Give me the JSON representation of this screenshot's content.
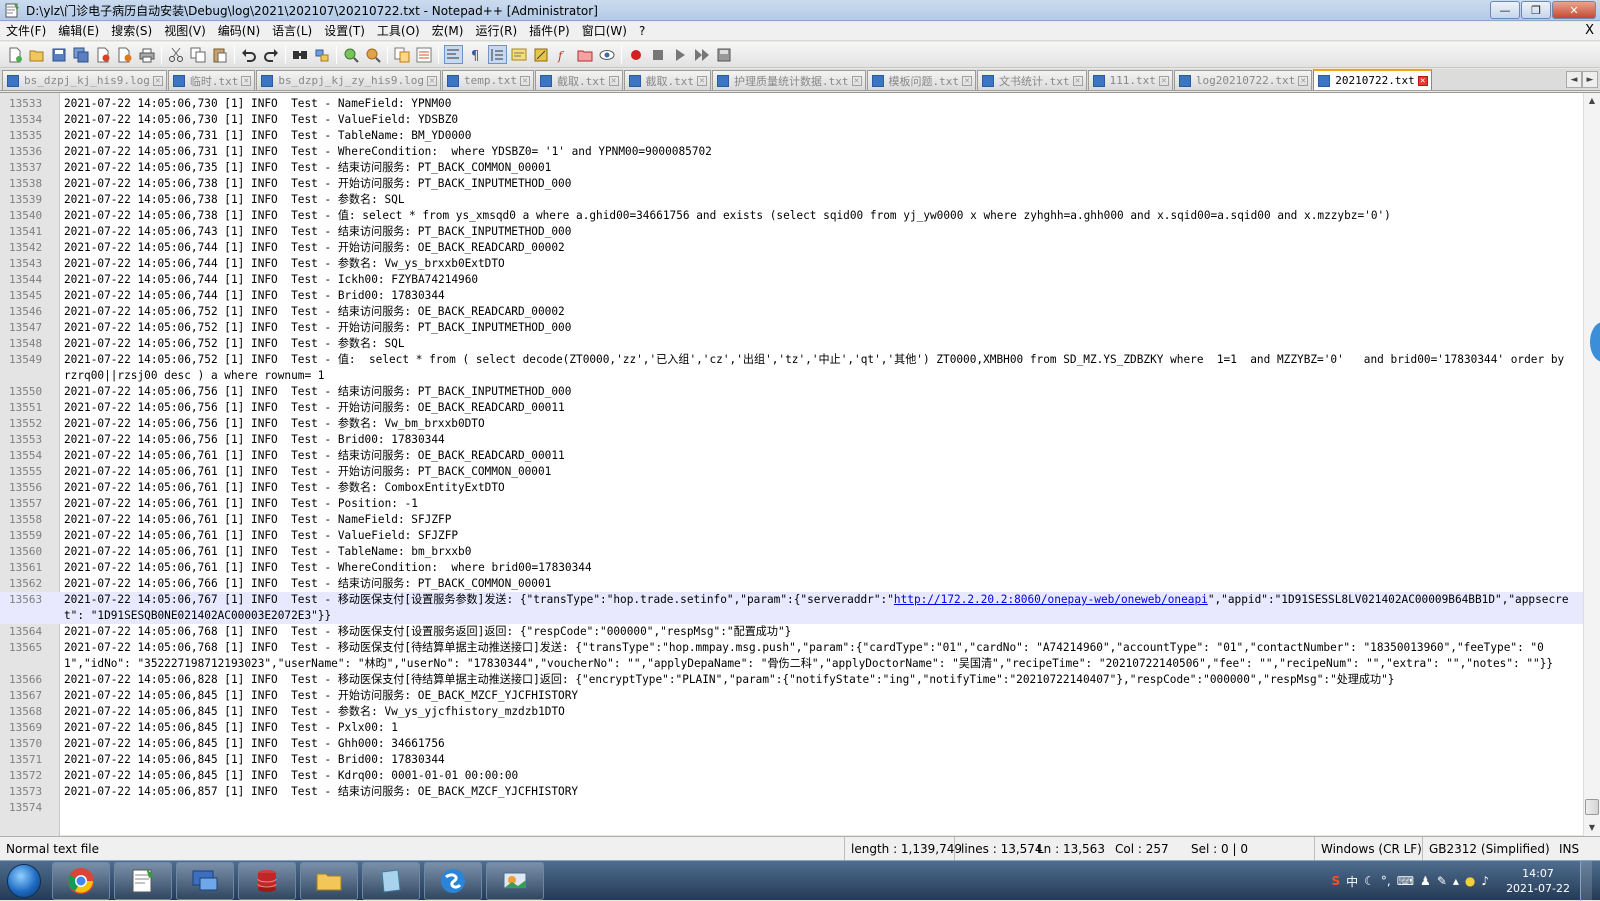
{
  "window": {
    "title": "D:\\ylz\\门诊电子病历自动安装\\Debug\\log\\2021\\202107\\20210722.txt - Notepad++ [Administrator]",
    "minimize": "—",
    "maximize": "❐",
    "close": "✕"
  },
  "menu": {
    "items": [
      "文件(F)",
      "编辑(E)",
      "搜索(S)",
      "视图(V)",
      "编码(N)",
      "语言(L)",
      "设置(T)",
      "工具(O)",
      "宏(M)",
      "运行(R)",
      "插件(P)",
      "窗口(W)",
      "?"
    ],
    "close": "X"
  },
  "tabs": [
    {
      "label": "bs_dzpj_kj_his9.log",
      "active": false
    },
    {
      "label": "临时.txt",
      "active": false
    },
    {
      "label": "bs_dzpj_kj_zy_his9.log",
      "active": false
    },
    {
      "label": "temp.txt",
      "active": false
    },
    {
      "label": "截取.txt",
      "active": false
    },
    {
      "label": "截取.txt",
      "active": false
    },
    {
      "label": "护理质量统计数据.txt",
      "active": false
    },
    {
      "label": "模板问题.txt",
      "active": false
    },
    {
      "label": "文书统计.txt",
      "active": false
    },
    {
      "label": "111.txt",
      "active": false
    },
    {
      "label": "log20210722.txt",
      "active": false
    },
    {
      "label": "20210722.txt",
      "active": true
    }
  ],
  "tab_nav": {
    "prev": "◄",
    "next": "►"
  },
  "editor": {
    "current_line": "13563",
    "lines": [
      {
        "n": "13533",
        "t": "2021-07-22 14:05:06,730 [1] INFO  Test - NameField: YPNM00"
      },
      {
        "n": "13534",
        "t": "2021-07-22 14:05:06,730 [1] INFO  Test - ValueField: YDSBZ0"
      },
      {
        "n": "13535",
        "t": "2021-07-22 14:05:06,731 [1] INFO  Test - TableName: BM_YD0000"
      },
      {
        "n": "13536",
        "t": "2021-07-22 14:05:06,731 [1] INFO  Test - WhereCondition:  where YDSBZ0= '1' and YPNM00=9000085702"
      },
      {
        "n": "13537",
        "t": "2021-07-22 14:05:06,735 [1] INFO  Test - 结束访问服务: PT_BACK_COMMON_00001"
      },
      {
        "n": "13538",
        "t": "2021-07-22 14:05:06,738 [1] INFO  Test - 开始访问服务: PT_BACK_INPUTMETHOD_000"
      },
      {
        "n": "13539",
        "t": "2021-07-22 14:05:06,738 [1] INFO  Test - 参数名: SQL"
      },
      {
        "n": "13540",
        "t": "2021-07-22 14:05:06,738 [1] INFO  Test - 值: select * from ys_xmsqd0 a where a.ghid00=34661756 and exists (select sqid00 from yj_yw0000 x where zyhghh=a.ghh000 and x.sqid00=a.sqid00 and x.mzzybz='0')"
      },
      {
        "n": "13541",
        "t": "2021-07-22 14:05:06,743 [1] INFO  Test - 结束访问服务: PT_BACK_INPUTMETHOD_000"
      },
      {
        "n": "13542",
        "t": "2021-07-22 14:05:06,744 [1] INFO  Test - 开始访问服务: OE_BACK_READCARD_00002"
      },
      {
        "n": "13543",
        "t": "2021-07-22 14:05:06,744 [1] INFO  Test - 参数名: Vw_ys_brxxb0ExtDTO"
      },
      {
        "n": "13544",
        "t": "2021-07-22 14:05:06,744 [1] INFO  Test - Ickh00: FZYBA74214960"
      },
      {
        "n": "13545",
        "t": "2021-07-22 14:05:06,744 [1] INFO  Test - Brid00: 17830344"
      },
      {
        "n": "13546",
        "t": "2021-07-22 14:05:06,752 [1] INFO  Test - 结束访问服务: OE_BACK_READCARD_00002"
      },
      {
        "n": "13547",
        "t": "2021-07-22 14:05:06,752 [1] INFO  Test - 开始访问服务: PT_BACK_INPUTMETHOD_000"
      },
      {
        "n": "13548",
        "t": "2021-07-22 14:05:06,752 [1] INFO  Test - 参数名: SQL"
      },
      {
        "n": "13549",
        "t": "2021-07-22 14:05:06,752 [1] INFO  Test - 值:  select * from ( select decode(ZT0000,'zz','已入组','cz','出组','tz','中止','qt','其他') ZT0000,XMBH00 from SD_MZ.YS_ZDBZKY where  1=1  and MZZYBZ='0'   and brid00='17830344' order by rzrq00||rzsj00 desc ) a where rownum= 1"
      },
      {
        "n": "13550",
        "t": "2021-07-22 14:05:06,756 [1] INFO  Test - 结束访问服务: PT_BACK_INPUTMETHOD_000"
      },
      {
        "n": "13551",
        "t": "2021-07-22 14:05:06,756 [1] INFO  Test - 开始访问服务: OE_BACK_READCARD_00011"
      },
      {
        "n": "13552",
        "t": "2021-07-22 14:05:06,756 [1] INFO  Test - 参数名: Vw_bm_brxxb0DTO"
      },
      {
        "n": "13553",
        "t": "2021-07-22 14:05:06,756 [1] INFO  Test - Brid00: 17830344"
      },
      {
        "n": "13554",
        "t": "2021-07-22 14:05:06,761 [1] INFO  Test - 结束访问服务: OE_BACK_READCARD_00011"
      },
      {
        "n": "13555",
        "t": "2021-07-22 14:05:06,761 [1] INFO  Test - 开始访问服务: PT_BACK_COMMON_00001"
      },
      {
        "n": "13556",
        "t": "2021-07-22 14:05:06,761 [1] INFO  Test - 参数名: ComboxEntityExtDTO"
      },
      {
        "n": "13557",
        "t": "2021-07-22 14:05:06,761 [1] INFO  Test - Position: -1"
      },
      {
        "n": "13558",
        "t": "2021-07-22 14:05:06,761 [1] INFO  Test - NameField: SFJZFP"
      },
      {
        "n": "13559",
        "t": "2021-07-22 14:05:06,761 [1] INFO  Test - ValueField: SFJZFP"
      },
      {
        "n": "13560",
        "t": "2021-07-22 14:05:06,761 [1] INFO  Test - TableName: bm_brxxb0"
      },
      {
        "n": "13561",
        "t": "2021-07-22 14:05:06,761 [1] INFO  Test - WhereCondition:  where brid00=17830344"
      },
      {
        "n": "13562",
        "t": "2021-07-22 14:05:06,766 [1] INFO  Test - 结束访问服务: PT_BACK_COMMON_00001"
      },
      {
        "n": "13563",
        "t": "2021-07-22 14:05:06,767 [1] INFO  Test - 移动医保支付[设置服务参数]发送: {\"transType\":\"hop.trade.setinfo\",\"param\":{\"serveraddr\":\"http://172.2.20.2:8060/onepay-web/oneweb/oneapi\",\"appid\":\"1D91SESSL8LV021402AC00009B64BB1D\",\"appsecret\": \"1D91SESQB0NE021402AC00003E2072E3\"}}",
        "current": true
      },
      {
        "n": "13564",
        "t": "2021-07-22 14:05:06,768 [1] INFO  Test - 移动医保支付[设置服务返回]返回: {\"respCode\":\"000000\",\"respMsg\":\"配置成功\"}"
      },
      {
        "n": "13565",
        "t": "2021-07-22 14:05:06,768 [1] INFO  Test - 移动医保支付[待结算单据主动推送接口]发送: {\"transType\":\"hop.mmpay.msg.push\",\"param\":{\"cardType\":\"01\",\"cardNo\": \"A74214960\",\"accountType\": \"01\",\"contactNumber\": \"18350013960\",\"feeType\": \"01\",\"idNo\": \"352227198712193023\",\"userName\": \"林昀\",\"userNo\": \"17830344\",\"voucherNo\": \"\",\"applyDepaName\": \"骨伤二科\",\"applyDoctorName\": \"吴国清\",\"recipeTime\": \"20210722140506\",\"fee\": \"\",\"recipeNum\": \"\",\"extra\": \"\",\"notes\": \"\"}}"
      },
      {
        "n": "13566",
        "t": "2021-07-22 14:05:06,828 [1] INFO  Test - 移动医保支付[待结算单据主动推送接口]返回: {\"encryptType\":\"PLAIN\",\"param\":{\"notifyState\":\"ing\",\"notifyTime\":\"20210722140407\"},\"respCode\":\"000000\",\"respMsg\":\"处理成功\"}"
      },
      {
        "n": "13567",
        "t": "2021-07-22 14:05:06,845 [1] INFO  Test - 开始访问服务: OE_BACK_MZCF_YJCFHISTORY"
      },
      {
        "n": "13568",
        "t": "2021-07-22 14:05:06,845 [1] INFO  Test - 参数名: Vw_ys_yjcfhistory_mzdzb1DTO"
      },
      {
        "n": "13569",
        "t": "2021-07-22 14:05:06,845 [1] INFO  Test - Pxlx00: 1"
      },
      {
        "n": "13570",
        "t": "2021-07-22 14:05:06,845 [1] INFO  Test - Ghh000: 34661756"
      },
      {
        "n": "13571",
        "t": "2021-07-22 14:05:06,845 [1] INFO  Test - Brid00: 17830344"
      },
      {
        "n": "13572",
        "t": "2021-07-22 14:05:06,845 [1] INFO  Test - Kdrq00: 0001-01-01 00:00:00"
      },
      {
        "n": "13573",
        "t": "2021-07-22 14:05:06,857 [1] INFO  Test - 结束访问服务: OE_BACK_MZCF_YJCFHISTORY"
      },
      {
        "n": "13574",
        "t": ""
      }
    ]
  },
  "status": {
    "filetype": "Normal text file",
    "length": "length : 1,139,749",
    "lines": "lines : 13,574",
    "ln": "Ln : 13,563",
    "col": "Col : 257",
    "sel": "Sel : 0 | 0",
    "eol": "Windows (CR LF)",
    "encoding": "GB2312 (Simplified)",
    "mode": "INS"
  },
  "taskbar": {
    "time": "14:07",
    "date": "2021-07-22",
    "tray_ime": "中",
    "tray_extra": "°,"
  },
  "colors": {
    "url": "#0000ee",
    "active_tab_accent": "#f4a21c",
    "current_line_bg": "#e8e8ff"
  }
}
